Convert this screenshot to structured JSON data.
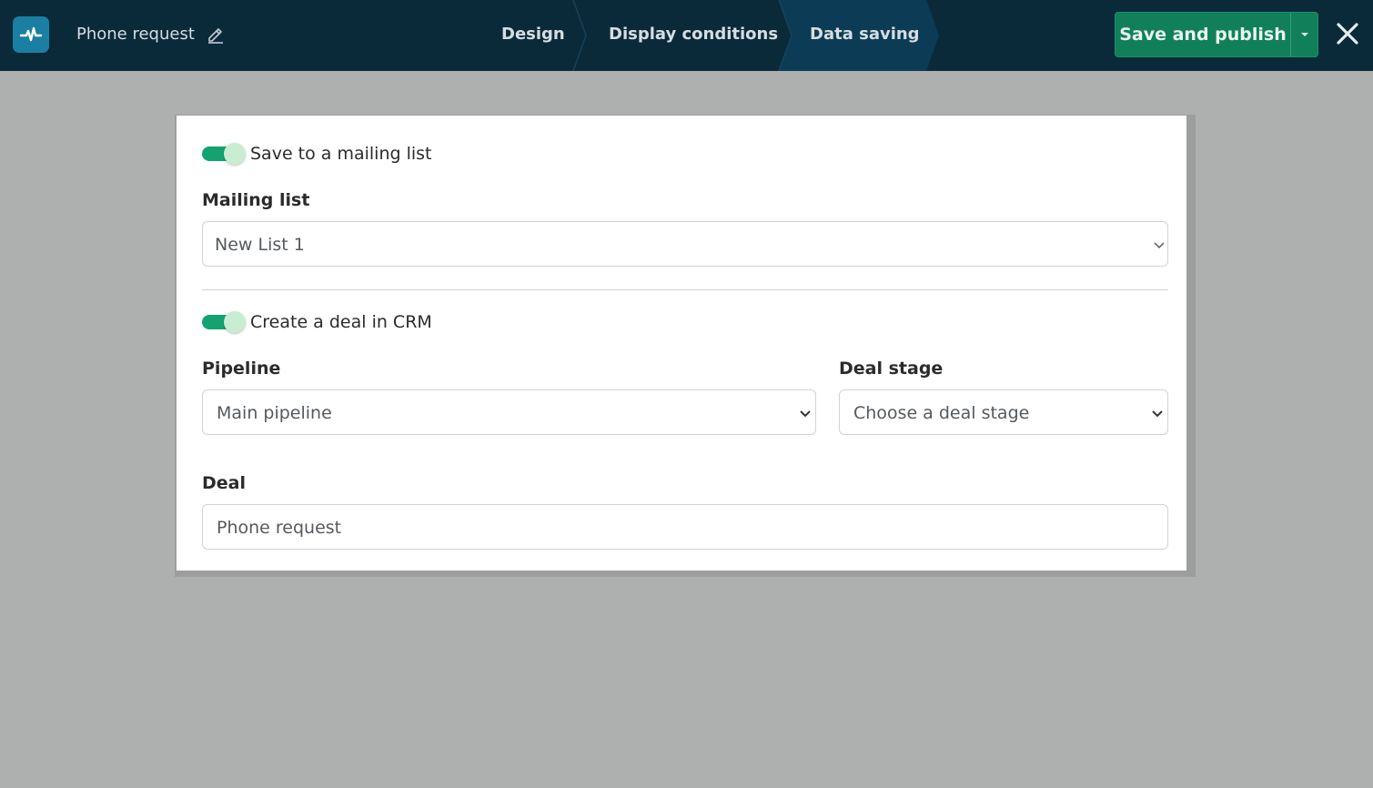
{
  "header": {
    "form_name": "Phone request",
    "steps": [
      {
        "label": "Design",
        "active": false
      },
      {
        "label": "Display conditions",
        "active": false
      },
      {
        "label": "Data saving",
        "active": true
      }
    ],
    "publish_label": "Save and publish",
    "icons": {
      "logo": "pulse-logo-icon",
      "edit": "pencil-icon",
      "publish_menu": "caret-down-icon",
      "close": "close-icon"
    }
  },
  "colors": {
    "topbar": "#0a2a3a",
    "active_step": "#0c3c55",
    "accent_green": "#11805a",
    "toggle_on": "#14a370",
    "page_bg": "#aeb0af"
  },
  "mailing": {
    "toggle_on": true,
    "toggle_label": "Save to a mailing list",
    "list_label": "Mailing list",
    "list_value": "New List 1"
  },
  "crm": {
    "toggle_on": true,
    "toggle_label": "Create a deal in CRM",
    "pipeline_label": "Pipeline",
    "pipeline_value": "Main pipeline",
    "stage_label": "Deal stage",
    "stage_value": "Choose a deal stage",
    "deal_label": "Deal",
    "deal_value": "Phone request"
  }
}
